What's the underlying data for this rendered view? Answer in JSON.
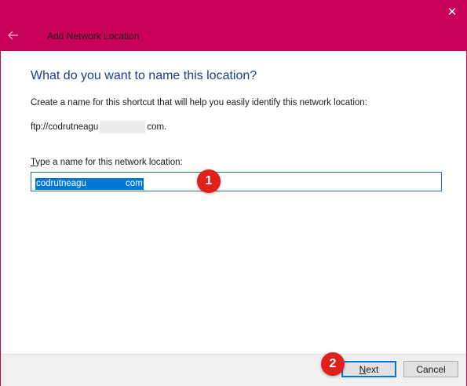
{
  "window": {
    "title": "Add Network Location",
    "close_glyph": "✕",
    "back_icon": "back-arrow-icon",
    "accent_color": "#c8005a"
  },
  "main": {
    "heading": "What do you want to name this location?",
    "description": "Create a name for this shortcut that will help you easily identify this network location:",
    "url_prefix": "ftp://codrutneagu",
    "url_suffix": "com.",
    "field_label_hotkey": "T",
    "field_label_rest": "ype a name for this network location:",
    "input_value_prefix": "codrutneagu",
    "input_value_suffix": "com"
  },
  "annotations": {
    "callout_1": "1",
    "callout_2": "2",
    "callout_color": "#e0201b"
  },
  "footer": {
    "next_hotkey": "N",
    "next_rest": "ext",
    "cancel_label": "Cancel"
  }
}
